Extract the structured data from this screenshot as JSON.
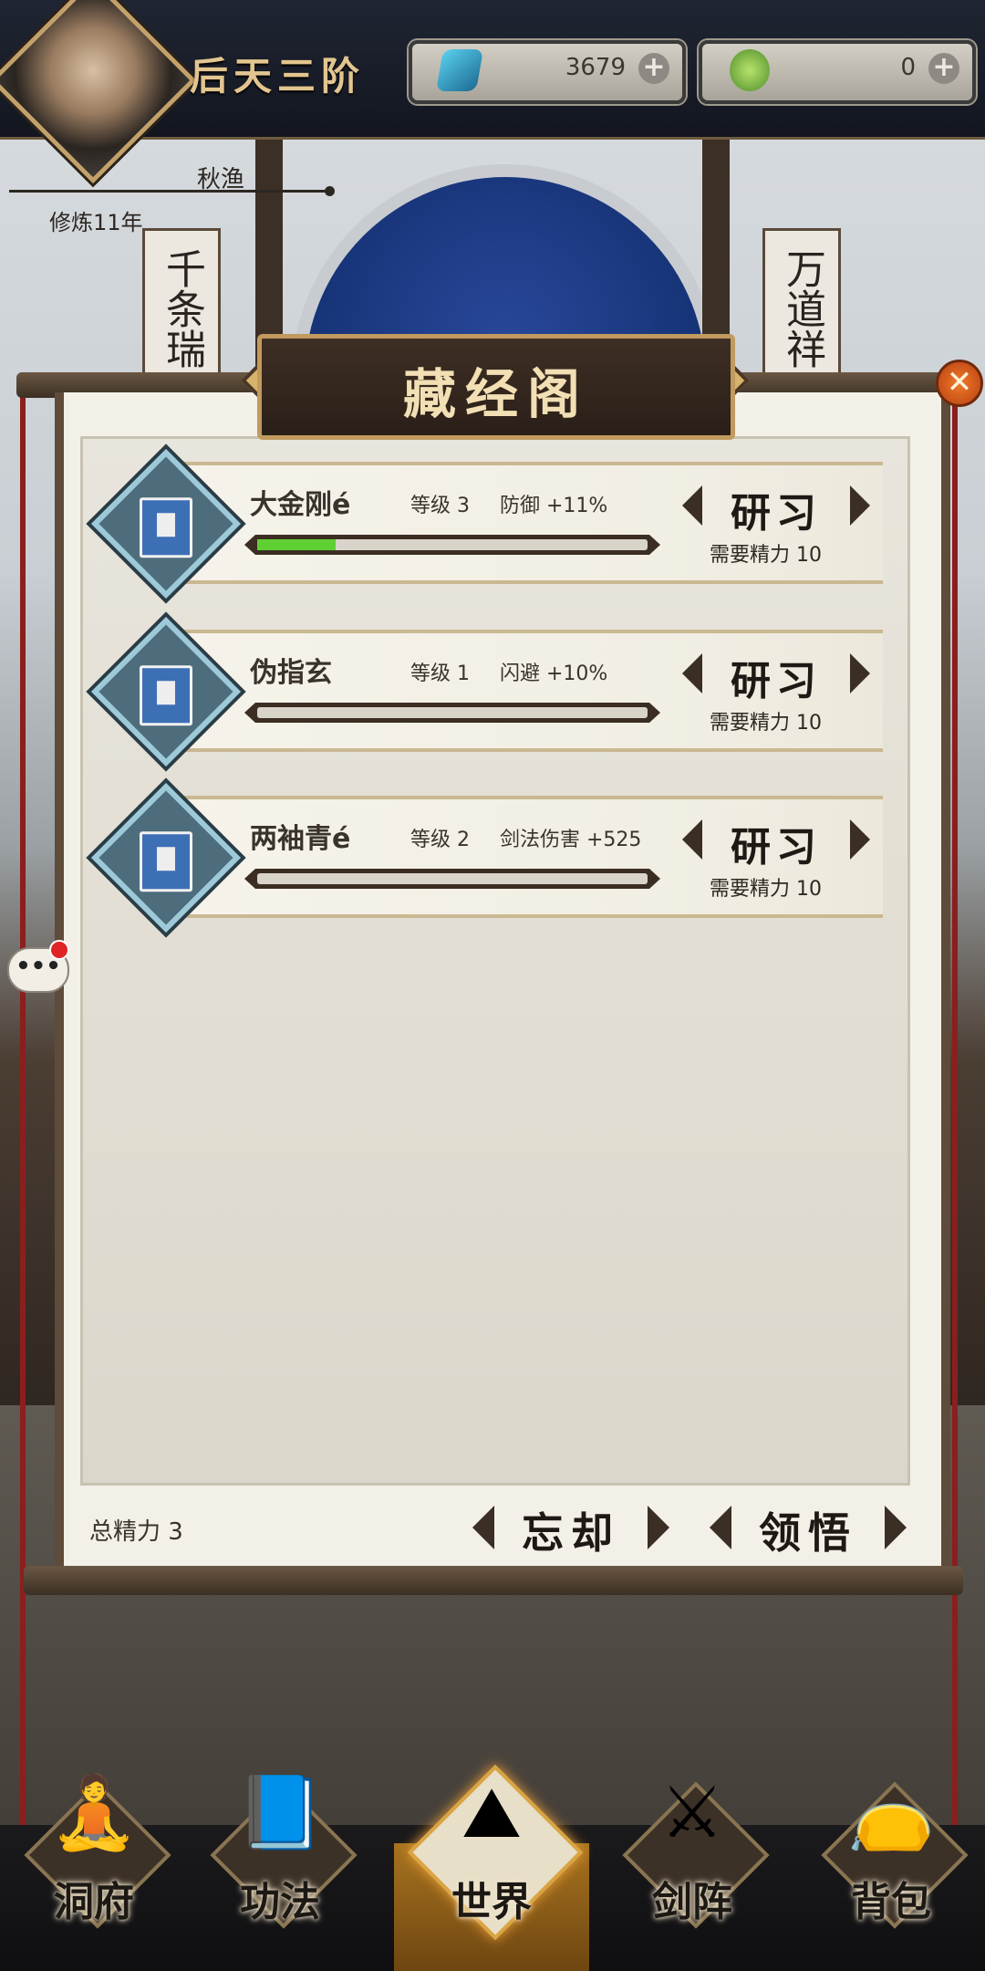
{
  "header": {
    "rank_title": "后天三阶",
    "player_name": "秋渔",
    "cultivate_years": "修炼11年",
    "currencies": [
      {
        "icon": "blue-crystal-icon",
        "value": "3679"
      },
      {
        "icon": "jade-coin-icon",
        "value": "0"
      }
    ]
  },
  "scene": {
    "banner_left": "千条瑞",
    "banner_right": "万道祥"
  },
  "panel": {
    "title": "藏经阁",
    "close_symbol": "✕",
    "skills": [
      {
        "name": "大金刚é",
        "level": "等级 3",
        "effect": "防御 +11%",
        "progress": 0.2,
        "button": "研习",
        "cost": "需要精力 10"
      },
      {
        "name": "伪指玄",
        "level": "等级 1",
        "effect": "闪避 +10%",
        "progress": 0,
        "button": "研习",
        "cost": "需要精力 10"
      },
      {
        "name": "两袖青é",
        "level": "等级 2",
        "effect": "剑法伤害 +525",
        "progress": 0,
        "button": "研习",
        "cost": "需要精力 10"
      }
    ],
    "total_energy": "总精力 3",
    "forget_button": "忘却",
    "comprehend_button": "领悟"
  },
  "chat": {
    "symbol": "•••"
  },
  "nav": {
    "items": [
      {
        "label": "洞府",
        "icon": "immortal-cave-icon",
        "glyph": "🧘"
      },
      {
        "label": "功法",
        "icon": "scripture-book-icon",
        "glyph": "📘"
      },
      {
        "label": "世界",
        "icon": "world-map-icon",
        "glyph": "⛰",
        "active": true
      },
      {
        "label": "剑阵",
        "icon": "sword-formation-icon",
        "glyph": "⚔"
      },
      {
        "label": "背包",
        "icon": "treasure-bag-icon",
        "glyph": "👝"
      }
    ]
  },
  "colors": {
    "progress_fill": "#5fd032",
    "panel_bg": "#f3f0e7",
    "title_text": "#f2dfb4",
    "accent_gold": "#c19a5e"
  }
}
